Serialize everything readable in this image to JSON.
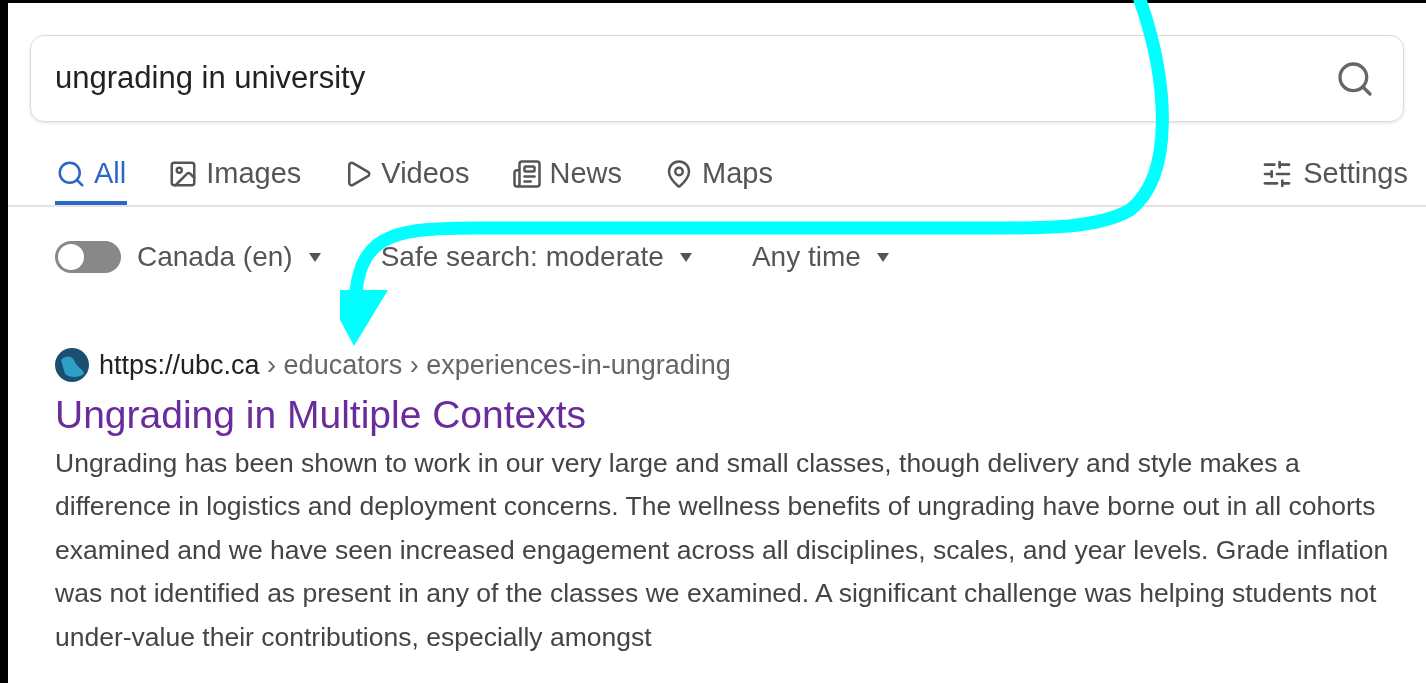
{
  "search": {
    "value": "ungrading in university"
  },
  "tabs": [
    {
      "label": "All",
      "selected": true
    },
    {
      "label": "Images",
      "selected": false
    },
    {
      "label": "Videos",
      "selected": false
    },
    {
      "label": "News",
      "selected": false
    },
    {
      "label": "Maps",
      "selected": false
    }
  ],
  "settings": {
    "label": "Settings"
  },
  "filters": {
    "region_toggle": {
      "on": false
    },
    "dropdowns": [
      "Canada (en)",
      "Safe search: moderate",
      "Any time"
    ]
  },
  "result": {
    "site": "https://ubc.ca",
    "path": [
      "› educators",
      "› experiences-in-ungrading"
    ],
    "title": "Ungrading in Multiple Contexts",
    "snippet": "Ungrading has been shown to work in our very large and small classes, though delivery and style makes a difference in logistics and deployment concerns. The wellness benefits of ungrading have borne out in all cohorts examined and we have seen increased engagement across all disciplines, scales, and year levels. Grade inflation was not identified as present in any of the classes we examined. A significant challenge was helping students not under-value their contributions, especially amongst"
  }
}
